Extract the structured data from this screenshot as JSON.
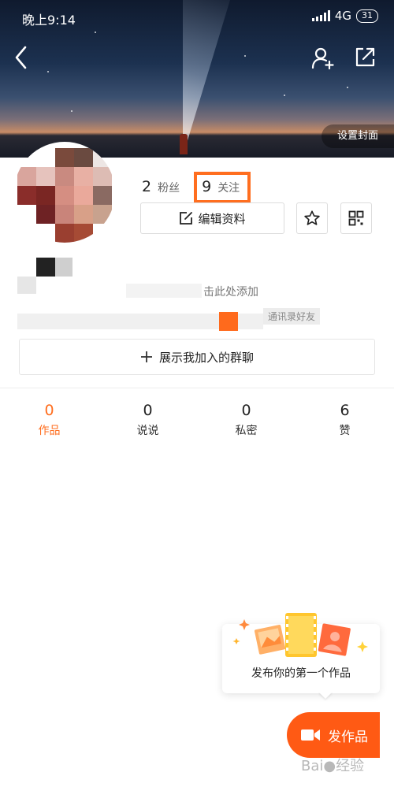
{
  "status_bar": {
    "time": "晚上9:14",
    "network": "4G",
    "battery": "31"
  },
  "header": {
    "back_icon": "chevron-left-icon",
    "add_friend_icon": "add-person-icon",
    "share_icon": "share-icon",
    "set_cover_label": "设置封面"
  },
  "profile": {
    "fans_count": "2",
    "fans_label": "粉丝",
    "following_count": "9",
    "following_label": "关注",
    "edit_label": "编辑资料",
    "hint_partial": "击此处添加",
    "hint_partial_2": "通讯录好友",
    "groups_label": "展示我加入的群聊"
  },
  "tabs": [
    {
      "count": "0",
      "label": "作品",
      "active": true
    },
    {
      "count": "0",
      "label": "说说",
      "active": false
    },
    {
      "count": "0",
      "label": "私密",
      "active": false
    },
    {
      "count": "6",
      "label": "赞",
      "active": false
    }
  ],
  "tip": {
    "text": "发布你的第一个作品"
  },
  "publish": {
    "label": "发作品"
  },
  "colors": {
    "accent": "#ff6e1f",
    "publish": "#ff5a14"
  }
}
